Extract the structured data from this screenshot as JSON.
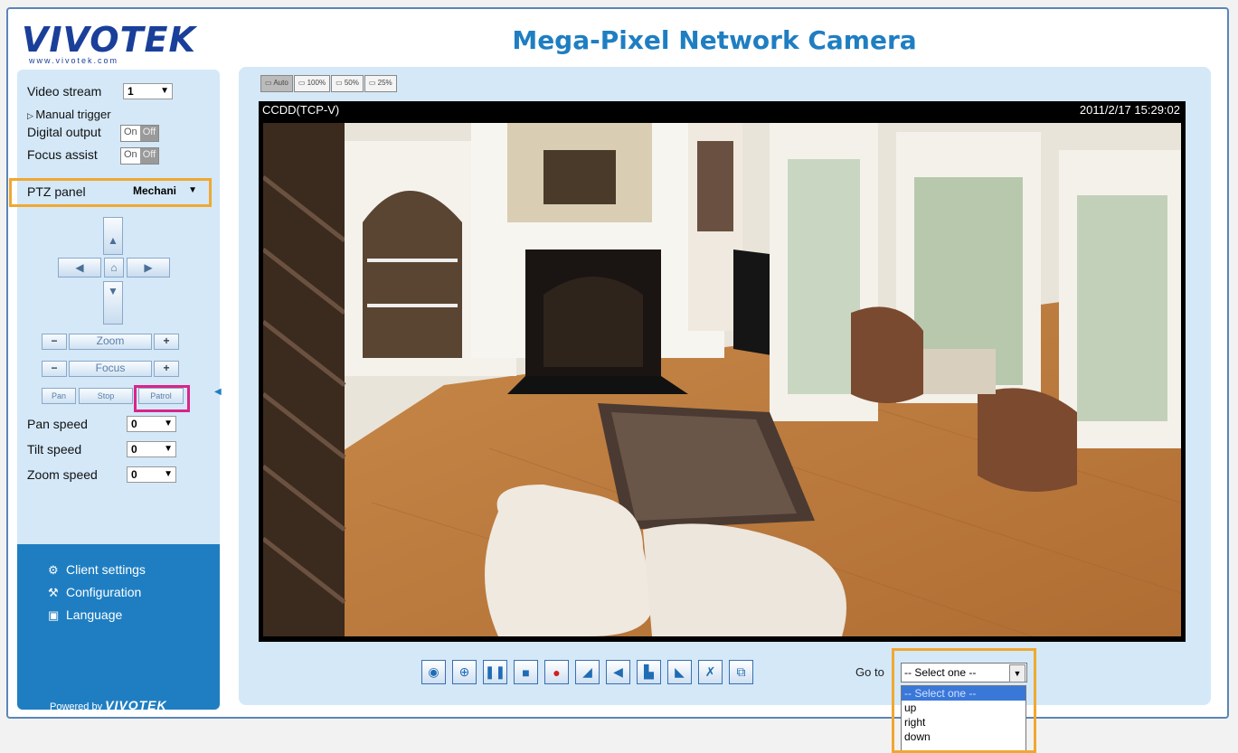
{
  "header": {
    "logo_text": "VIVOTEK",
    "logo_url": "www.vivotek.com",
    "title": "Mega-Pixel Network Camera"
  },
  "sidebar": {
    "video_stream_label": "Video stream",
    "video_stream_value": "1",
    "manual_trigger": "Manual trigger",
    "digital_output_label": "Digital output",
    "focus_assist_label": "Focus assist",
    "on_label": "On",
    "off_label": "Off",
    "ptz_panel_label": "PTZ panel",
    "ptz_panel_value": "Mechani",
    "zoom_label": "Zoom",
    "focus_label": "Focus",
    "minus": "−",
    "plus": "+",
    "pan_label": "Pan",
    "stop_label": "Stop",
    "patrol_label": "Patrol",
    "pan_speed_label": "Pan speed",
    "pan_speed_value": "0",
    "tilt_speed_label": "Tilt speed",
    "tilt_speed_value": "0",
    "zoom_speed_label": "Zoom speed",
    "zoom_speed_value": "0",
    "menu": [
      {
        "label": "Client settings"
      },
      {
        "label": "Configuration"
      },
      {
        "label": "Language"
      }
    ],
    "powered_by": "Powered by",
    "powered_brand": "VIVOTEK"
  },
  "main": {
    "zoom_tabs": [
      "Auto",
      "100%",
      "50%",
      "25%"
    ],
    "stream_caption": "CCDD(TCP-V)",
    "timestamp": "2011/2/17 15:29:02",
    "goto_label": "Go to",
    "goto_value": "-- Select one --",
    "goto_options": [
      "-- Select one --",
      "up",
      "right",
      "down"
    ]
  },
  "colors": {
    "accent": "#1f7ec2",
    "panel": "#d4e8f8",
    "highlight_orange": "#f0a830",
    "highlight_pink": "#d8258a"
  }
}
